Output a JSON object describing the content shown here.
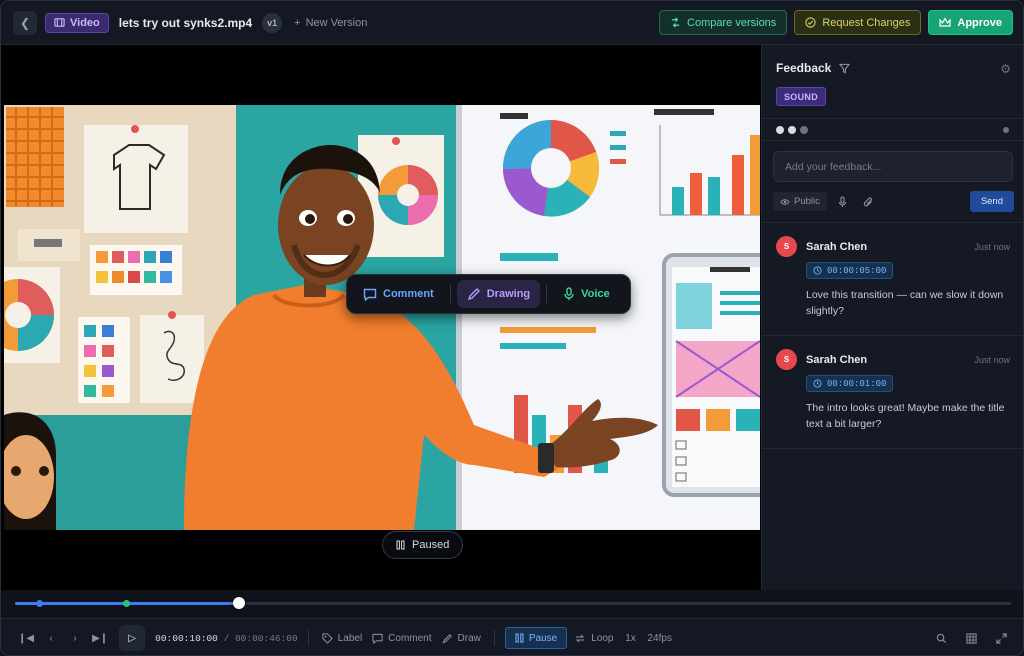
{
  "header": {
    "back_icon": "chevron-left-icon",
    "badge_label": "Video",
    "file_title": "lets try out synks2.mp4",
    "version": "v1",
    "new_version_label": "New Version",
    "compare_label": "Compare versions",
    "request_label": "Request Changes",
    "approve_label": "Approve"
  },
  "player": {
    "toolbar": {
      "comment_label": "Comment",
      "drawing_label": "Drawing",
      "voice_label": "Voice"
    },
    "status_label": "Paused"
  },
  "feedback": {
    "title": "Feedback",
    "filter_tag": "SOUND",
    "input_placeholder": "Add your feedback...",
    "visibility_label": "Public",
    "send_label": "Send",
    "comments": [
      {
        "initial": "S",
        "author": "Sarah Chen",
        "time": "Just now",
        "timestamp": "00:00:05:00",
        "text": "Love this transition — can we slow it down slightly?"
      },
      {
        "initial": "S",
        "author": "Sarah Chen",
        "time": "Just now",
        "timestamp": "00:00:01:00",
        "text": "The intro looks great! Maybe make the title text a bit larger?"
      }
    ]
  },
  "timeline": {
    "current_time": "00:00:10:00",
    "duration": "00:00:46:00",
    "progress_fraction": 0.2245,
    "markers": [
      {
        "at": 0.0245,
        "color": "#3f7cf0"
      },
      {
        "at": 0.1123,
        "color": "#28c76f"
      }
    ]
  },
  "controls": {
    "label_label": "Label",
    "comment_label": "Comment",
    "draw_label": "Draw",
    "pause_label": "Pause",
    "loop_label": "Loop",
    "speed": "1x",
    "fps": "24fps"
  },
  "colors": {
    "accent": "#3f7cf0",
    "approve": "#17a474",
    "avatar": "#e5484d"
  }
}
